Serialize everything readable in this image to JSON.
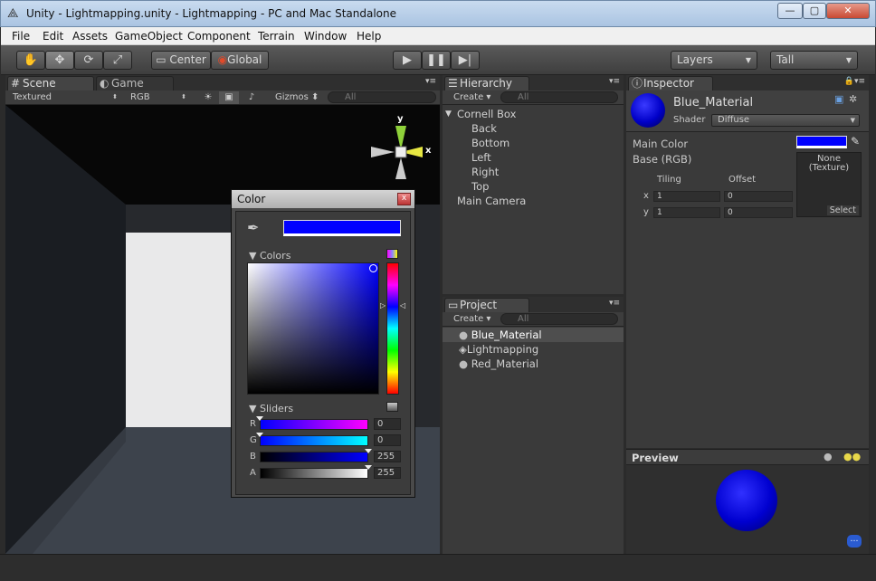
{
  "window": {
    "title": "Unity - Lightmapping.unity - Lightmapping - PC and Mac Standalone",
    "min": "—",
    "max": "▢",
    "close": "✕"
  },
  "menu": [
    "File",
    "Edit",
    "Assets",
    "GameObject",
    "Component",
    "Terrain",
    "Window",
    "Help"
  ],
  "toolbar": {
    "pivot": "Center",
    "space": "Global",
    "layers": "Layers",
    "layout": "Tall"
  },
  "scene": {
    "tabs": [
      "Scene",
      "Game"
    ],
    "render_mode": "Textured",
    "color_mode": "RGB",
    "gizmos": "Gizmos",
    "search": "All",
    "axis_x": "x",
    "axis_y": "y"
  },
  "hierarchy": {
    "tab": "Hierarchy",
    "create": "Create",
    "search": "All",
    "items": [
      {
        "label": "Cornell Box",
        "indent": 0,
        "arrow": "▼"
      },
      {
        "label": "Back",
        "indent": 1
      },
      {
        "label": "Bottom",
        "indent": 1
      },
      {
        "label": "Left",
        "indent": 1
      },
      {
        "label": "Right",
        "indent": 1
      },
      {
        "label": "Top",
        "indent": 1
      },
      {
        "label": "Main Camera",
        "indent": 0
      }
    ]
  },
  "project": {
    "tab": "Project",
    "create": "Create",
    "search": "All",
    "items": [
      "Blue_Material",
      "Lightmapping",
      "Red_Material"
    ]
  },
  "inspector": {
    "tab": "Inspector",
    "material": "Blue_Material",
    "shader_label": "Shader",
    "shader": "Diffuse",
    "main_color": "Main Color",
    "base": "Base (RGB)",
    "tiling": "Tiling",
    "offset": "Offset",
    "x": "x",
    "y": "y",
    "tx": "1",
    "ty": "1",
    "ox": "0",
    "oy": "0",
    "texture": "None\n(Texture)",
    "select": "Select",
    "color": "#0000ff"
  },
  "preview": {
    "title": "Preview"
  },
  "color_dialog": {
    "title": "Color",
    "colors": "Colors",
    "sliders": "Sliders",
    "r_label": "R",
    "g_label": "G",
    "b_label": "B",
    "a_label": "A",
    "r": 0,
    "g": 0,
    "b": 255,
    "a": 255,
    "r_text": "0",
    "g_text": "0",
    "b_text": "255",
    "a_text": "255",
    "close": "x"
  }
}
